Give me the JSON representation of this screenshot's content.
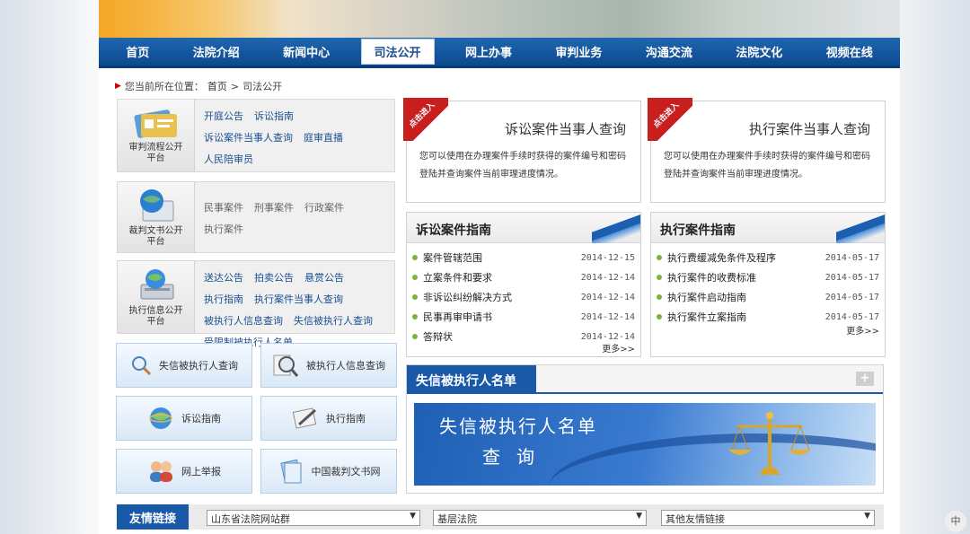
{
  "nav": [
    "首页",
    "法院介绍",
    "新闻中心",
    "司法公开",
    "网上办事",
    "审判业务",
    "沟通交流",
    "法院文化",
    "视频在线"
  ],
  "active_nav": 3,
  "breadcrumb": {
    "prefix": "您当前所在位置：",
    "home": "首页",
    "sep": ">",
    "current": "司法公开"
  },
  "platforms": [
    {
      "title": "审判流程公开平台",
      "links": [
        "开庭公告",
        "诉讼指南",
        "诉讼案件当事人查询",
        "庭审直播",
        "人民陪审员"
      ]
    },
    {
      "title": "裁判文书公开平台",
      "links": [
        "民事案件",
        "刑事案件",
        "行政案件",
        "执行案件"
      ]
    },
    {
      "title": "执行信息公开平台",
      "links": [
        "送达公告",
        "拍卖公告",
        "悬赏公告",
        "执行指南",
        "执行案件当事人查询",
        "被执行人信息查询",
        "失信被执行人查询",
        "受限制被执行人名单"
      ]
    }
  ],
  "tiles": [
    "失信被执行人查询",
    "被执行人信息查询",
    "诉讼指南",
    "执行指南",
    "网上举报",
    "中国裁判文书网"
  ],
  "query_boxes": [
    {
      "ribbon": "点击进入",
      "title": "诉讼案件当事人查询",
      "desc": "您可以使用在办理案件手续时获得的案件编号和密码登陆并查询案件当前审理进度情况。"
    },
    {
      "ribbon": "点击进入",
      "title": "执行案件当事人查询",
      "desc": "您可以使用在办理案件手续时获得的案件编号和密码登陆并查询案件当前审理进度情况。"
    }
  ],
  "guides": [
    {
      "title": "诉讼案件指南",
      "items": [
        {
          "label": "案件管辖范围",
          "date": "2014-12-15"
        },
        {
          "label": "立案条件和要求",
          "date": "2014-12-14"
        },
        {
          "label": "非诉讼纠纷解决方式",
          "date": "2014-12-14"
        },
        {
          "label": "民事再审申请书",
          "date": "2014-12-14"
        },
        {
          "label": "答辩状",
          "date": "2014-12-14"
        }
      ]
    },
    {
      "title": "执行案件指南",
      "items": [
        {
          "label": "执行费缓减免条件及程序",
          "date": "2014-05-17"
        },
        {
          "label": "执行案件的收费标准",
          "date": "2014-05-17"
        },
        {
          "label": "执行案件启动指南",
          "date": "2014-05-17"
        },
        {
          "label": "执行案件立案指南",
          "date": "2014-05-17"
        }
      ]
    }
  ],
  "more_label": "更多>>",
  "blacklist": {
    "title": "失信被执行人名单",
    "plus": "+",
    "banner_line1": "失信被执行人名单",
    "banner_line2": "查询"
  },
  "friends": {
    "title": "友情链接",
    "selects": [
      "山东省法院网站群",
      "基层法院",
      "其他友情链接"
    ],
    "arrow": "▼"
  },
  "corner_label": "中"
}
